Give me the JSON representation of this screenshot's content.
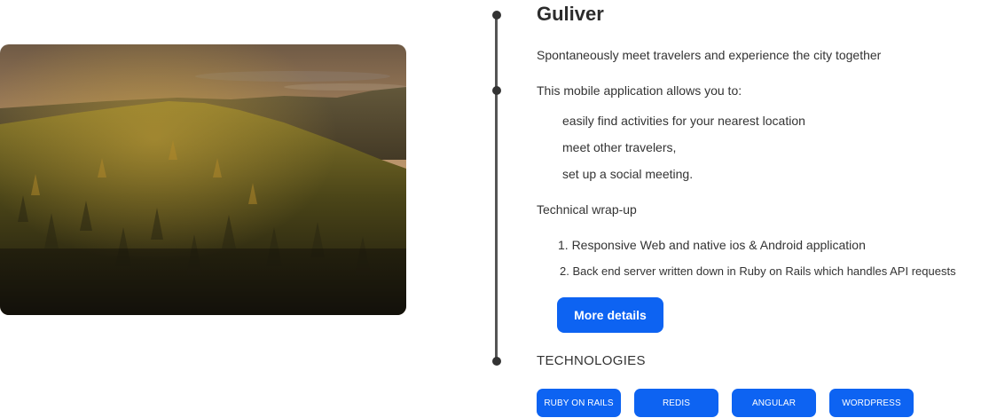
{
  "project": {
    "title": "Guliver",
    "tagline": "Spontaneously meet travelers and experience the city together",
    "intro": "This mobile application allows you to:",
    "features": [
      "easily find activities for your nearest location",
      "meet other travelers,",
      "set up a social meeting."
    ],
    "tech_wrapup_label": "Technical wrap-up",
    "tech_wrapup_items": [
      "1. Responsive Web and native ios & Android application",
      "2. Back end server written down in Ruby on Rails which handles API requests"
    ],
    "more_button_label": "More details",
    "technologies_label": "TECHNOLOGIES",
    "technologies": [
      "RUBY ON RAILS",
      "REDIS",
      "ANGULAR",
      "WORDPRESS"
    ]
  },
  "colors": {
    "accent": "#0d63f2",
    "timeline": "#555555",
    "text": "#333333"
  },
  "image": {
    "subject": "sunset over forested hills"
  }
}
